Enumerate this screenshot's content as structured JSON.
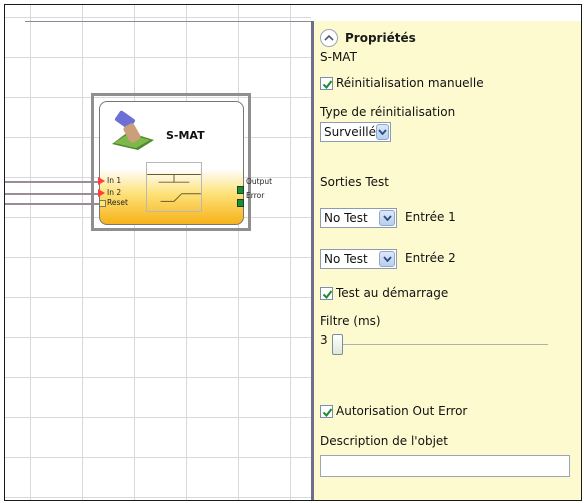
{
  "block": {
    "title": "S-MAT",
    "inputs": [
      "In 1",
      "In 2",
      "Reset"
    ],
    "outputs": [
      "Output",
      "Error"
    ]
  },
  "properties": {
    "title": "Propriétés",
    "object_name": "S-MAT",
    "manual_reset": {
      "label": "Réinitialisation manuelle",
      "checked": true
    },
    "reset_type": {
      "label": "Type de réinitialisation",
      "value": "Surveillé"
    },
    "test_outputs": {
      "label": "Sorties Test",
      "rows": [
        {
          "value": "No Test",
          "label": "Entrée 1"
        },
        {
          "value": "No Test",
          "label": "Entrée 2"
        }
      ]
    },
    "startup_test": {
      "label": "Test au démarrage",
      "checked": true
    },
    "filter": {
      "label": "Filtre (ms)",
      "value": "3"
    },
    "out_error": {
      "label": "Autorisation Out Error",
      "checked": true
    },
    "description": {
      "label": "Description de l'objet",
      "value": ""
    }
  },
  "colors": {
    "panel_bg": "#fdfad0",
    "block_gradient_bottom": "#f6b21a",
    "input_pin": "#ff3b3b",
    "output_pin": "#1f8a3a",
    "checkbox_check": "#1c8a2e"
  }
}
